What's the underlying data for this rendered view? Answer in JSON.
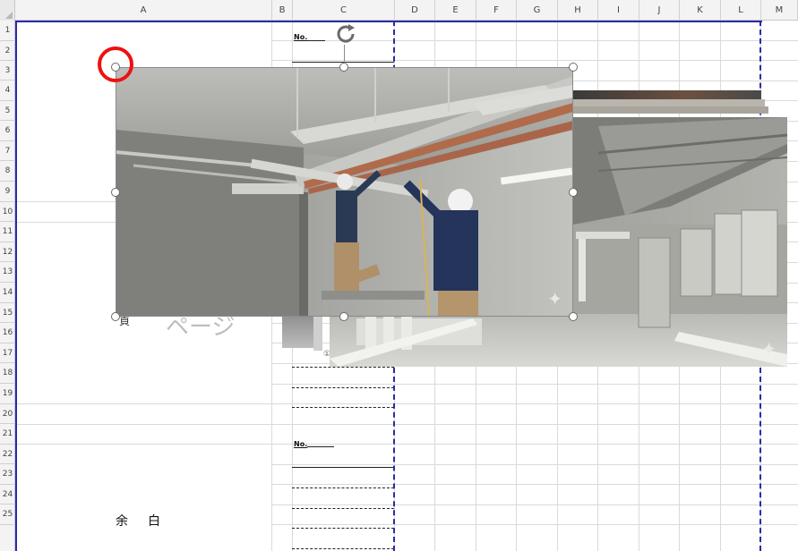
{
  "columns": [
    "A",
    "B",
    "C",
    "D",
    "E",
    "F",
    "G",
    "H",
    "I",
    "J",
    "K",
    "L",
    "M"
  ],
  "rows": [
    "1",
    "2",
    "3",
    "4",
    "5",
    "6",
    "7",
    "8",
    "9",
    "10",
    "11",
    "12",
    "13",
    "14",
    "15",
    "16",
    "17",
    "18",
    "19",
    "20",
    "21",
    "22",
    "23",
    "24",
    "25"
  ],
  "cells": {
    "no_label_1": "No.",
    "no_label_2": "No.",
    "yohaku": "余白",
    "background_page_text": "ページ",
    "background_fragment": "頁",
    "circle_marker_char": "①"
  },
  "icons": {
    "rotate": "rotate-handle-icon",
    "sparkle": "sparkle-icon"
  },
  "colors": {
    "page_break": "#2a2aa8",
    "highlight_circle": "#e11111",
    "header_bg": "#f3f3f3"
  }
}
